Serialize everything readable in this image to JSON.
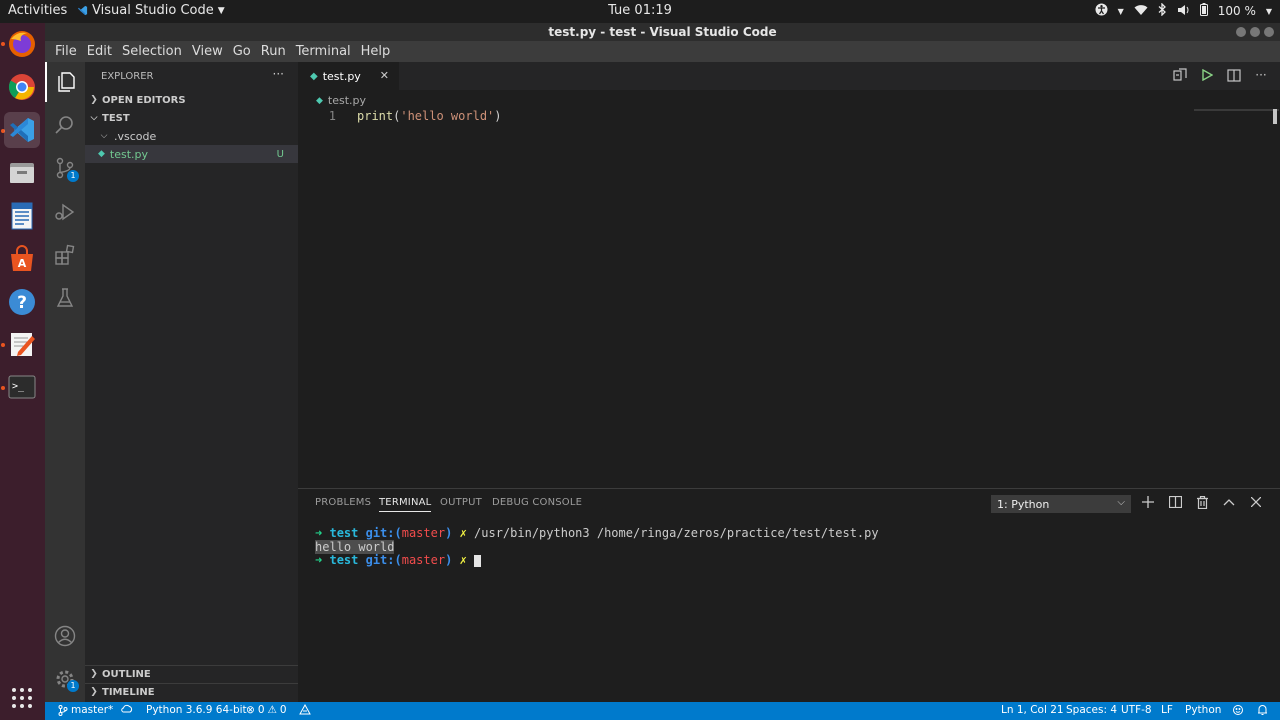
{
  "topbar": {
    "activities": "Activities",
    "app": "Visual Studio Code",
    "clock": "Tue 01:19",
    "battery": "100 %"
  },
  "window": {
    "title": "test.py - test - Visual Studio Code"
  },
  "menu": [
    "File",
    "Edit",
    "Selection",
    "View",
    "Go",
    "Run",
    "Terminal",
    "Help"
  ],
  "activitybar": {
    "scm_badge": "1",
    "manage_badge": "1"
  },
  "sidebar": {
    "header": "EXPLORER",
    "open_editors": "OPEN EDITORS",
    "folder": "TEST",
    "items": [
      {
        "label": ".vscode"
      },
      {
        "label": "test.py",
        "status": "U"
      }
    ],
    "outline": "OUTLINE",
    "timeline": "TIMELINE"
  },
  "editor": {
    "tab_label": "test.py",
    "breadcrumb": "test.py",
    "line_number": "1",
    "code_fn": "print",
    "code_open": "(",
    "code_str": "'hello world'",
    "code_close": ")"
  },
  "panel": {
    "tabs": [
      "PROBLEMS",
      "TERMINAL",
      "OUTPUT",
      "DEBUG CONSOLE"
    ],
    "terminal_select": "1: Python",
    "lines": [
      {
        "dir": "test",
        "git": "git:(",
        "branch": "master",
        "git_close": ")",
        "cmd": "/usr/bin/python3 /home/ringa/zeros/practice/test/test.py"
      },
      {
        "output": "hello world"
      },
      {
        "dir": "test",
        "git": "git:(",
        "branch": "master",
        "git_close": ")",
        "cmd": ""
      }
    ],
    "prompt_arrow": "➜",
    "prompt_x": "✗"
  },
  "statusbar": {
    "branch": "master*",
    "interpreter": "Python 3.6.9 64-bit",
    "errors": "0",
    "warnings": "0",
    "position": "Ln 1, Col 21",
    "spaces": "Spaces: 4",
    "encoding": "UTF-8",
    "eol": "LF",
    "language": "Python"
  },
  "colors": {
    "statusbar": "#007acc",
    "editor_bg": "#1e1e1e",
    "sidebar_bg": "#252526",
    "dock_bg": "#3c1e2c"
  }
}
